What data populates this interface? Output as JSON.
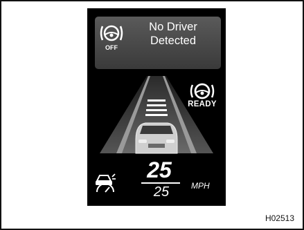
{
  "notice": {
    "message_line1": "No Driver",
    "message_line2": "Detected",
    "icon": "steering-wheel-off-icon",
    "icon_caption": "OFF"
  },
  "ready": {
    "label": "READY",
    "icon": "steering-wheel-ready-icon"
  },
  "speed": {
    "current": "25",
    "set": "25",
    "unit": "MPH"
  },
  "cruise": {
    "icon": "adaptive-cruise-icon"
  },
  "figure": {
    "code": "H02513"
  },
  "colors": {
    "display_bg": "#000000",
    "card_bg": "#4a4a4a",
    "lane": "#8a8a8a",
    "text": "#ffffff"
  }
}
